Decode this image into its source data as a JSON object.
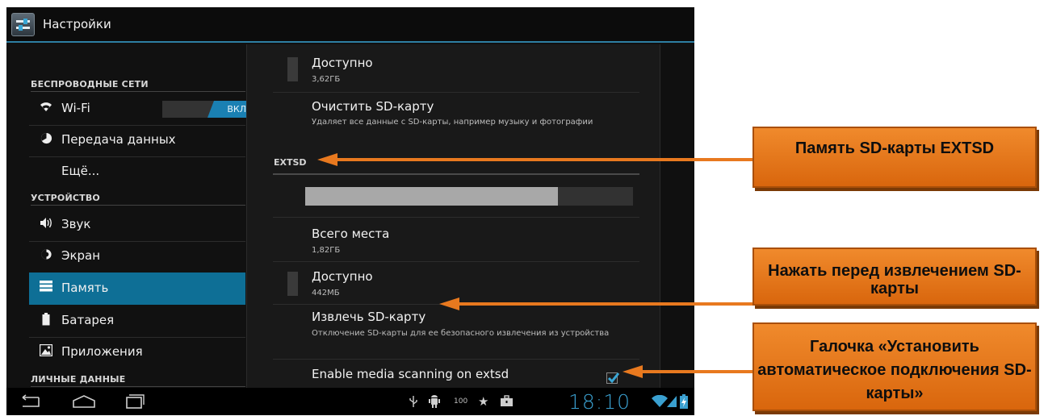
{
  "app": {
    "title": "Настройки"
  },
  "sidebar": {
    "categories": {
      "wireless": "БЕСПРОВОДНЫЕ СЕТИ",
      "device": "УСТРОЙСТВО",
      "personal": "ЛИЧНЫЕ ДАННЫЕ"
    },
    "items": [
      {
        "label": "Wi-Fi",
        "icon": "wifi-icon"
      },
      {
        "label": "Передача данных",
        "icon": "data-usage-icon"
      },
      {
        "label": "Ещё...",
        "icon": ""
      },
      {
        "label": "Звук",
        "icon": "speaker-icon"
      },
      {
        "label": "Экран",
        "icon": "display-icon"
      },
      {
        "label": "Память",
        "icon": "storage-icon",
        "active": true
      },
      {
        "label": "Батарея",
        "icon": "battery-icon"
      },
      {
        "label": "Приложения",
        "icon": "apps-icon"
      }
    ],
    "wifi_toggle": "ВКЛ"
  },
  "storage": {
    "internal_available": {
      "title": "Доступно",
      "value": "3,62ГБ"
    },
    "erase": {
      "title": "Очистить SD-карту",
      "subtitle": "Удаляет все данные с SD-карты, например музыку и фотографии"
    },
    "extsd_header": "EXTSD",
    "extsd_used_fraction": 0.77,
    "total": {
      "title": "Всего места",
      "value": "1,82ГБ"
    },
    "available": {
      "title": "Доступно",
      "value": "442МБ"
    },
    "eject": {
      "title": "Извлечь SD-карту",
      "subtitle": "Отключение SD-карты для ее безопасного извлечения из устройства"
    },
    "media_scan": {
      "title": "Enable media scanning on extsd",
      "checked": true
    }
  },
  "status_bar": {
    "battery_text": "100",
    "time": "18:10"
  },
  "annotations": {
    "callout1": "Память SD-карты EXTSD",
    "callout2": "Нажать перед извлечением SD-карты",
    "callout3": "Галочка «Установить автоматическое подключения SD-карты»"
  },
  "colors": {
    "accent": "#0e6f96",
    "callout": "#e8791f"
  }
}
